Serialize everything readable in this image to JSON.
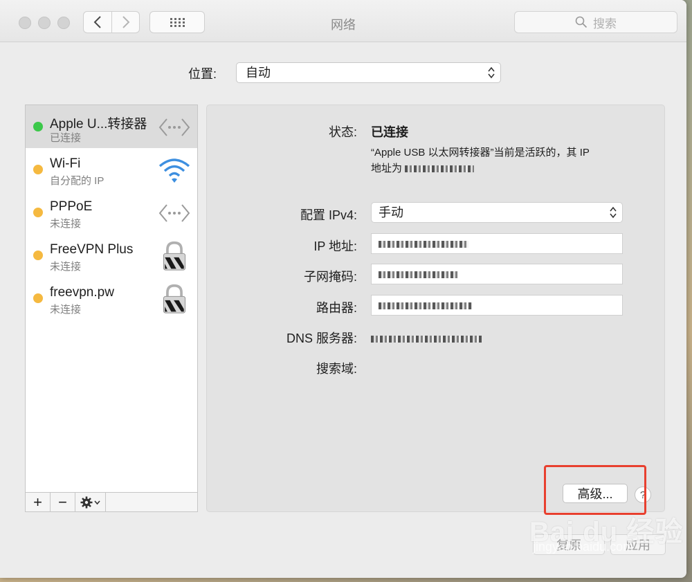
{
  "window": {
    "title": "网络",
    "search_placeholder": "搜索"
  },
  "location": {
    "label": "位置:",
    "value": "自动"
  },
  "services": [
    {
      "name": "Apple U...转接器",
      "status": "已连接",
      "dot_color": "#3cc84a",
      "icon": "ethernet-icon"
    },
    {
      "name": "Wi-Fi",
      "status": "自分配的 IP",
      "dot_color": "#f5b940",
      "icon": "wifi-icon"
    },
    {
      "name": "PPPoE",
      "status": "未连接",
      "dot_color": "#f5b940",
      "icon": "ethernet-icon"
    },
    {
      "name": "FreeVPN Plus",
      "status": "未连接",
      "dot_color": "#f5b940",
      "icon": "lock-icon"
    },
    {
      "name": "freevpn.pw",
      "status": "未连接",
      "dot_color": "#f5b940",
      "icon": "lock-icon"
    }
  ],
  "sidebar_toolbar": {
    "add": "+",
    "remove": "−"
  },
  "detail": {
    "status_label": "状态:",
    "status_value": "已连接",
    "status_desc_line1": "“Apple USB 以太网转接器”当前是活跃的，其 IP",
    "status_desc_line2": "地址为",
    "ipv4_label": "配置 IPv4:",
    "ipv4_value": "手动",
    "ip_label": "IP 地址:",
    "subnet_label": "子网掩码:",
    "router_label": "路由器:",
    "dns_label": "DNS 服务器:",
    "search_domain_label": "搜索域:",
    "advanced_button": "高级...",
    "help_button": "?"
  },
  "bottom": {
    "revert_button": "复原",
    "apply_button": "应用"
  },
  "watermark": {
    "brand": "Bai du 经验",
    "url": "jingyan.baidu.com"
  },
  "accent": {
    "highlight_color": "#e8402f"
  }
}
